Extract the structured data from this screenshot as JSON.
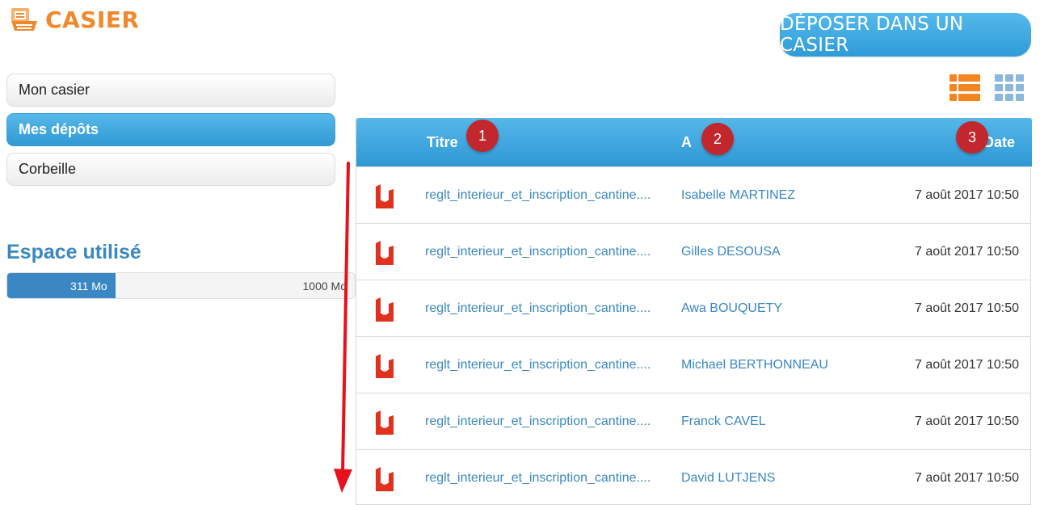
{
  "app": {
    "title": "CASIER",
    "deposit_label": "DÉPOSER DANS UN CASIER"
  },
  "sidebar": {
    "items": [
      {
        "label": "Mon casier",
        "active": false
      },
      {
        "label": "Mes dépôts",
        "active": true
      },
      {
        "label": "Corbeille",
        "active": false
      }
    ]
  },
  "storage": {
    "title": "Espace utilisé",
    "used": "311 Mo",
    "total": "1000 Mo",
    "used_fraction": 0.311
  },
  "view_toggle": {
    "list_icon": "list-view-icon",
    "grid_icon": "grid-view-icon",
    "active": "list"
  },
  "table": {
    "columns": [
      {
        "label": "Titre",
        "badge": "1"
      },
      {
        "label": "A",
        "badge": "2"
      },
      {
        "label": "Date",
        "badge": "3"
      }
    ],
    "rows": [
      {
        "title": "reglt_interieur_et_inscription_cantine....",
        "to": "Isabelle MARTINEZ",
        "date": "7 août 2017 10:50"
      },
      {
        "title": "reglt_interieur_et_inscription_cantine....",
        "to": "Gilles DESOUSA",
        "date": "7 août 2017 10:50"
      },
      {
        "title": "reglt_interieur_et_inscription_cantine....",
        "to": "Awa BOUQUETY",
        "date": "7 août 2017 10:50"
      },
      {
        "title": "reglt_interieur_et_inscription_cantine....",
        "to": "Michael BERTHONNEAU",
        "date": "7 août 2017 10:50"
      },
      {
        "title": "reglt_interieur_et_inscription_cantine....",
        "to": "Franck CAVEL",
        "date": "7 août 2017 10:50"
      },
      {
        "title": "reglt_interieur_et_inscription_cantine....",
        "to": "David LUTJENS",
        "date": "7 août 2017 10:50"
      }
    ]
  },
  "colors": {
    "brand_orange": "#f0892b",
    "header_blue": "#3199d4",
    "link_blue": "#3a88c0",
    "badge_red": "#c1272d",
    "pdf_red": "#e0301e",
    "arrow_red": "#e8101a"
  }
}
